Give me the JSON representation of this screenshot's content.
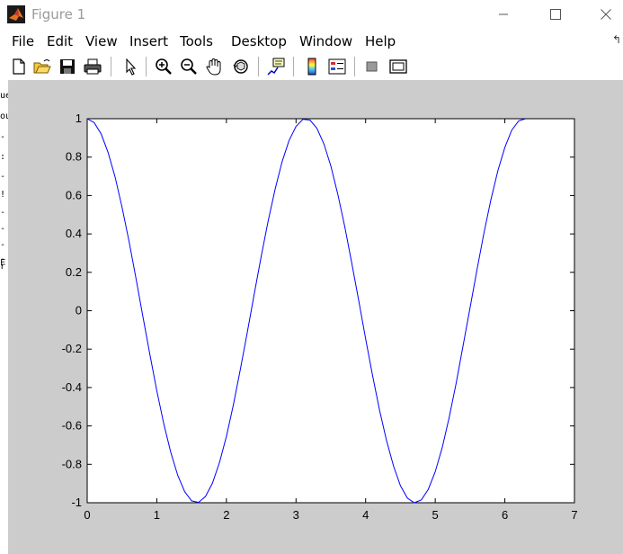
{
  "window": {
    "title": "Figure 1",
    "icons": {
      "app": "matlab-icon",
      "minimize": "minimize-icon",
      "maximize": "maximize-icon",
      "close": "close-icon"
    }
  },
  "menubar": {
    "items": [
      "File",
      "Edit",
      "View",
      "Insert",
      "Tools",
      "Desktop",
      "Window",
      "Help"
    ],
    "overflow_arrow": "↰"
  },
  "toolbar": {
    "buttons": [
      {
        "name": "new-figure-icon"
      },
      {
        "name": "open-file-icon"
      },
      {
        "name": "save-icon"
      },
      {
        "name": "print-icon"
      },
      {
        "name": "edit-plot-arrow-icon"
      },
      {
        "name": "zoom-in-icon"
      },
      {
        "name": "zoom-out-icon"
      },
      {
        "name": "pan-hand-icon"
      },
      {
        "name": "rotate-3d-icon"
      },
      {
        "name": "data-cursor-icon"
      },
      {
        "name": "colorbar-icon"
      },
      {
        "name": "legend-icon"
      },
      {
        "name": "hide-plot-tools-icon"
      },
      {
        "name": "show-plot-tools-icon"
      }
    ]
  },
  "sliver_text": [
    "ue",
    "ou",
    "-",
    ":",
    "-",
    "!",
    "-",
    "-",
    "-",
    "-",
    "F",
    "r"
  ],
  "chart_data": {
    "type": "line",
    "title": "",
    "xlabel": "",
    "ylabel": "",
    "xlim": [
      0,
      7
    ],
    "ylim": [
      -1,
      1
    ],
    "xticks": [
      0,
      1,
      2,
      3,
      4,
      5,
      6,
      7
    ],
    "yticks": [
      1,
      0.8,
      0.6,
      0.4,
      0.2,
      0,
      -0.2,
      -0.4,
      -0.6,
      -0.8,
      -1
    ],
    "ytick_labels": [
      "1",
      "0.8",
      "0.6",
      "0.4",
      "0.2",
      "0",
      "-0.2",
      "-0.4",
      "-0.6",
      "-0.8",
      "-1"
    ],
    "xtick_labels": [
      "0",
      "1",
      "2",
      "3",
      "4",
      "5",
      "6",
      "7"
    ],
    "grid": false,
    "series": [
      {
        "color": "#0000ff",
        "x": [
          0,
          0.1,
          0.2,
          0.3,
          0.4,
          0.5,
          0.6,
          0.7,
          0.8,
          0.9,
          1.0,
          1.1,
          1.2,
          1.3,
          1.4,
          1.5,
          1.6,
          1.7,
          1.8,
          1.9,
          2.0,
          2.1,
          2.2,
          2.3,
          2.4,
          2.5,
          2.6,
          2.7,
          2.8,
          2.9,
          3.0,
          3.1,
          3.2,
          3.3,
          3.4,
          3.5,
          3.6,
          3.7,
          3.8,
          3.9,
          4.0,
          4.1,
          4.2,
          4.3,
          4.4,
          4.5,
          4.6,
          4.7,
          4.8,
          4.9,
          5.0,
          5.1,
          5.2,
          5.3,
          5.4,
          5.5,
          5.6,
          5.7,
          5.8,
          5.9,
          6.0,
          6.1,
          6.2,
          6.3
        ],
        "y": [
          1.0,
          0.98,
          0.921,
          0.825,
          0.697,
          0.54,
          0.362,
          0.17,
          -0.029,
          -0.227,
          -0.416,
          -0.589,
          -0.737,
          -0.857,
          -0.942,
          -0.99,
          -0.998,
          -0.967,
          -0.897,
          -0.791,
          -0.654,
          -0.49,
          -0.307,
          -0.112,
          0.087,
          0.284,
          0.468,
          0.634,
          0.776,
          0.886,
          0.96,
          0.997,
          0.993,
          0.95,
          0.869,
          0.754,
          0.608,
          0.438,
          0.25,
          0.054,
          -0.146,
          -0.339,
          -0.518,
          -0.675,
          -0.808,
          -0.911,
          -0.976,
          -1.0,
          -0.985,
          -0.93,
          -0.839,
          -0.713,
          -0.557,
          -0.378,
          -0.182,
          0.016,
          0.214,
          0.404,
          0.579,
          0.729,
          0.851,
          0.941,
          0.989,
          1.0
        ]
      }
    ]
  }
}
